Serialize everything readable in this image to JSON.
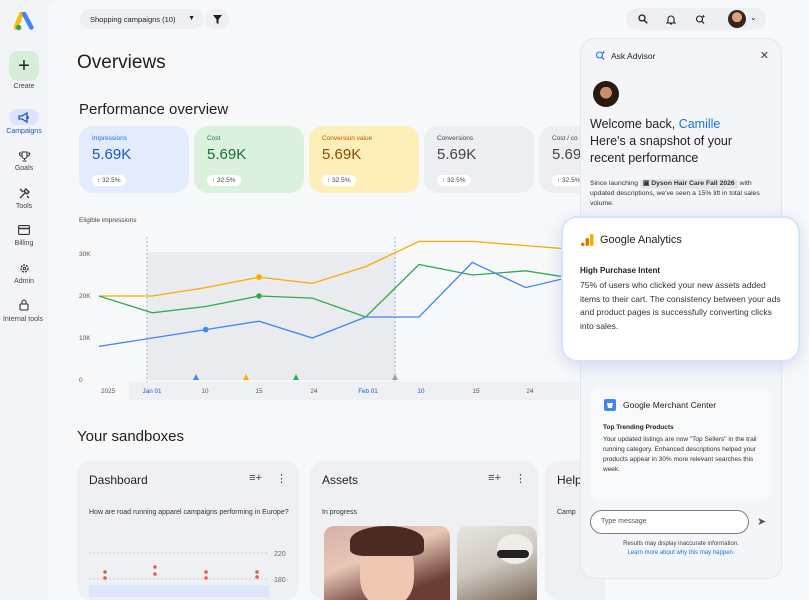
{
  "rail": {
    "create": "Create",
    "items": [
      {
        "label": "Campaigns",
        "icon": "megaphone-icon"
      },
      {
        "label": "Goals",
        "icon": "trophy-icon"
      },
      {
        "label": "Tools",
        "icon": "tools-icon"
      },
      {
        "label": "Billing",
        "icon": "credit-card-icon"
      },
      {
        "label": "Admin",
        "icon": "gear-icon"
      },
      {
        "label": "Internal tools",
        "icon": "lock-icon"
      }
    ]
  },
  "header": {
    "filter_label": "Shopping campaigns (10)",
    "icons": [
      "search-icon",
      "bell-icon",
      "advisor-sparkle-icon",
      "avatar"
    ]
  },
  "page_title": "Overviews",
  "performance": {
    "title": "Performance overview",
    "metrics": [
      {
        "label": "Impressions",
        "value": "5.69K",
        "change": "↑ 32.5%",
        "color": "#e3ecfd",
        "label_color": "#1a73e8"
      },
      {
        "label": "Cost",
        "value": "5.69K",
        "change": "↑ 32.5%",
        "color": "#dcf1dd",
        "label_color": "#188038"
      },
      {
        "label": "Conversion value",
        "value": "5.69K",
        "change": "↑ 32.5%",
        "color": "#feefb8",
        "label_color": "#b06000"
      },
      {
        "label": "Conversions",
        "value": "5.69K",
        "change": "↑ 32.5%",
        "color": "#eceef2",
        "label_color": "#444"
      },
      {
        "label": "Cost / co",
        "value": "5.69",
        "change": "↑ 32.5%",
        "color": "#eceef2",
        "label_color": "#444"
      }
    ]
  },
  "chart_data": {
    "type": "line",
    "title": "Eligible impressions",
    "y_ticks": [
      "0",
      "10K",
      "20K",
      "30K"
    ],
    "x_ticks": [
      "2025",
      "Jan 01",
      "10",
      "15",
      "24",
      "Feb 01",
      "10",
      "15",
      "24"
    ],
    "ylim": [
      0,
      30000
    ],
    "series": [
      {
        "color": "#f9ab00",
        "values": [
          20000,
          20000,
          22000,
          24500,
          23000,
          27000,
          33000,
          33000,
          32000,
          31000
        ]
      },
      {
        "color": "#34a853",
        "values": [
          20000,
          16000,
          17500,
          20000,
          19500,
          15000,
          27500,
          25000,
          26000,
          24000
        ]
      },
      {
        "color": "#4285f4",
        "values": [
          8000,
          10000,
          12000,
          14000,
          10000,
          15000,
          15000,
          28000,
          22000,
          25000
        ]
      }
    ],
    "grid": false
  },
  "sandboxes": {
    "title": "Your sandboxes",
    "cards": [
      {
        "title": "Dashboard",
        "text": "How are road running apparel campaigns performing in Europe?",
        "y_ticks": [
          "220",
          "180"
        ]
      },
      {
        "title": "Assets",
        "text": "In progress"
      },
      {
        "title": "Help",
        "text": "Camp"
      }
    ]
  },
  "advisor": {
    "title": "Ask Advisor",
    "welcome_prefix": "Welcome back, ",
    "welcome_name": "Camille",
    "welcome_line2": "Here's a snapshot of your recent performance",
    "body_prefix": "Since launching ",
    "campaign_chip": "Dyson Hair Care Fall 2026",
    "body_suffix": " with updated descriptions, we've seen a 15% lift in total sales volume.",
    "gmc": {
      "title": "Google Merchant Center",
      "subtitle": "Top Trending Products",
      "body": "Your updated listings are now \"Top Sellers\" in the trail running category. Enhanced descriptions helped your products appear in 30% more relevant searches this week."
    },
    "input_placeholder": "Type message",
    "disclaimer": "Results may display inaccurate information.",
    "disclaimer_link": "Learn more about why this may happen."
  },
  "ga_card": {
    "title": "Google Analytics",
    "subtitle": "High Purchase Intent",
    "body": "75% of users who clicked your new assets added items to their cart. The consistency between your ads and product pages is successfully converting clicks into sales."
  }
}
